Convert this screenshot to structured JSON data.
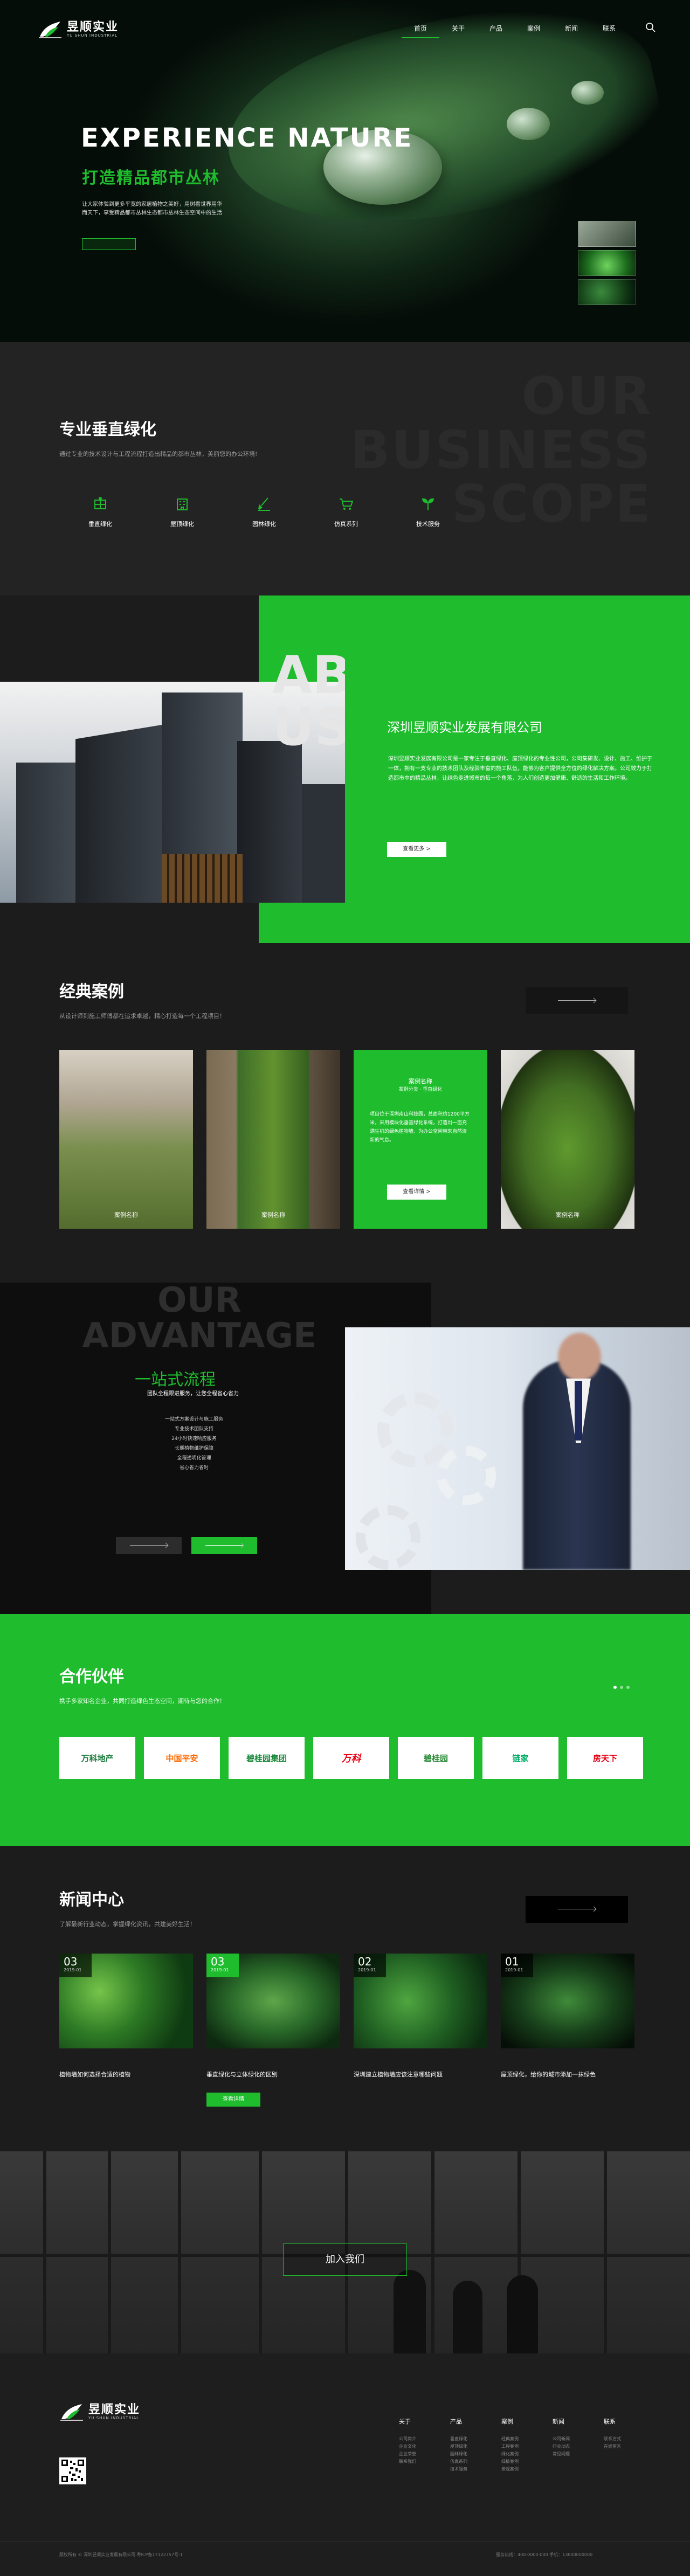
{
  "brand": {
    "name_cn": "昱顺实业",
    "name_en": "YU SHUN INDUSTRIAL"
  },
  "nav": {
    "items": [
      {
        "label": "首页",
        "active": true
      },
      {
        "label": "关于",
        "active": false
      },
      {
        "label": "产品",
        "active": false
      },
      {
        "label": "案例",
        "active": false
      },
      {
        "label": "新闻",
        "active": false
      },
      {
        "label": "联系",
        "active": false
      }
    ]
  },
  "hero": {
    "title": "EXPERIENCE NATURE",
    "subtitle": "打造精品都市丛林",
    "desc": "让大家体验到更多平宽的家居植物之美好，用树看世界用华而天下，享受精品都市丛林生态都市丛林生态空间中的生活"
  },
  "scope": {
    "bg_text": "OUR BUSINESS SCOPE",
    "title": "专业垂直绿化",
    "sub": "通过专业的技术设计与工程流程打造出精品的都市丛林，美丽您的办公环境!",
    "items": [
      {
        "label": "垂直绿化",
        "icon": "wall-icon"
      },
      {
        "label": "屋顶绿化",
        "icon": "building-icon"
      },
      {
        "label": "园林绿化",
        "icon": "shovel-icon"
      },
      {
        "label": "仿真系列",
        "icon": "cart-icon"
      },
      {
        "label": "技术服务",
        "icon": "sprout-icon"
      }
    ]
  },
  "about": {
    "bg_text": "ABOUT US",
    "company": "深圳昱顺实业发展有限公司",
    "text": "深圳昱顺实业发展有限公司是一家专注于垂直绿化、屋顶绿化的专业性公司，公司集研发、设计、施工、维护于一体，拥有一支专业的技术团队及经验丰富的施工队伍，能够为客户提供全方位的绿化解决方案。公司致力于打造都市中的精品丛林，让绿色走进城市的每一个角落，为人们创造更加健康、舒适的生活和工作环境。",
    "more": "查看更多 >"
  },
  "cases": {
    "title": "经典案例",
    "sub": "从设计师到施工师傅都在追求卓越，精心打造每一个工程项目！",
    "items": [
      {
        "caption": "案例名称"
      },
      {
        "caption": "案例名称"
      },
      {
        "title": "案例名称",
        "sub": "案例分类 · 垂直绿化",
        "text": "项目位于深圳南山科技园，总面积约1200平方米，采用模块化垂直绿化系统，打造出一面充满生机的绿色植物墙，为办公空间带来自然清新的气息。",
        "btn": "查看详情 >"
      },
      {
        "caption": "案例名称"
      }
    ]
  },
  "advantage": {
    "bg_text": "OUR ADVANTAGE",
    "title": "一站式流程",
    "sub": "团队全程跟进服务，让您全程省心省力",
    "lines": [
      "一站式方案设计与施工服务",
      "专业技术团队支持",
      "24小时快速响应服务",
      "长期植物维护保障",
      "全程透明化管理",
      "省心省力省时"
    ]
  },
  "partners": {
    "title": "合作伙伴",
    "sub": "携手多家知名企业，共同打造绿色生态空间，期待与您的合作！",
    "logos": [
      "万科地产",
      "中国平安",
      "碧桂园集团",
      "万科",
      "碧桂园",
      "链家",
      "房天下"
    ]
  },
  "news": {
    "title": "新闻中心",
    "sub": "了解最新行业动态，掌握绿化资讯，共建美好生活！",
    "items": [
      {
        "day": "03",
        "ym": "2019-01",
        "title": "植物墙如何选择合适的植物"
      },
      {
        "day": "03",
        "ym": "2019-01",
        "title": "垂直绿化与立体绿化的区别",
        "btn": "查看详情"
      },
      {
        "day": "02",
        "ym": "2019-01",
        "title": "深圳建立植物墙应该注意哪些问题"
      },
      {
        "day": "01",
        "ym": "2019-01",
        "title": "屋顶绿化，给你的城市添加一抹绿色"
      }
    ]
  },
  "join": {
    "label": "加入我们"
  },
  "footer": {
    "cols": [
      {
        "h": "关于",
        "links": [
          "公司简介",
          "企业文化",
          "企业荣誉",
          "联系我们"
        ]
      },
      {
        "h": "产品",
        "links": [
          "垂直绿化",
          "屋顶绿化",
          "园林绿化",
          "仿真系列",
          "技术服务"
        ]
      },
      {
        "h": "案例",
        "links": [
          "经典案例",
          "工程案例",
          "绿化案例",
          "绿植案例",
          "景观案例"
        ]
      },
      {
        "h": "新闻",
        "links": [
          "公司新闻",
          "行业动态",
          "常见问题"
        ]
      },
      {
        "h": "联系",
        "links": [
          "联系方式",
          "在线留言"
        ]
      }
    ],
    "copyright": "版权所有 © 深圳昱顺实业发展有限公司  粤ICP备17122757号-1",
    "contact": "服务热线：400-0000-000  手机：13800000000"
  }
}
